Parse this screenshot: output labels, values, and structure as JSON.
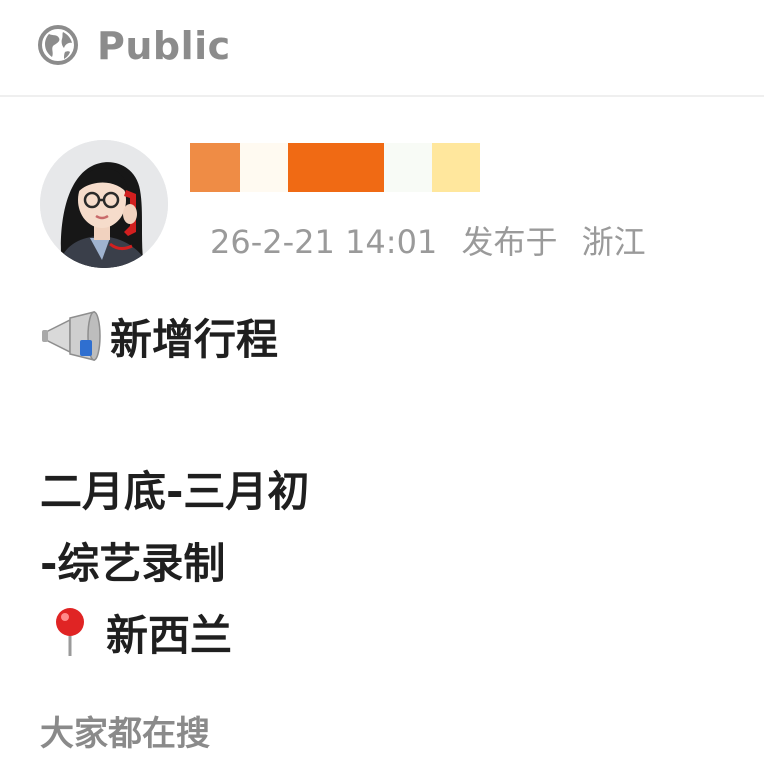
{
  "header": {
    "visibility_label": "Public",
    "icon": "globe-icon"
  },
  "post": {
    "author": {
      "avatar_icon": "avatar",
      "name_redaction_colors": [
        "#ef8c45",
        "#fffaf1",
        "#f06a14",
        "#f8fbf6",
        "#ffe79d"
      ]
    },
    "timestamp": "26-2-21 14:01",
    "location_prefix": "发布于",
    "location": "浙江",
    "lines": [
      {
        "emoji": "megaphone-icon",
        "text": "新增行程"
      },
      {
        "emoji": "",
        "text": ""
      },
      {
        "emoji": "",
        "text": "二月底-三月初"
      },
      {
        "emoji": "",
        "text": "-综艺录制"
      },
      {
        "emoji": "pin-icon",
        "text": "新西兰"
      }
    ]
  },
  "footer": {
    "trending_label": "大家都在搜"
  },
  "colors": {
    "meta_text": "#9a9a9a",
    "header_text": "#8c8c8c",
    "body_text": "#1f1f1f"
  }
}
